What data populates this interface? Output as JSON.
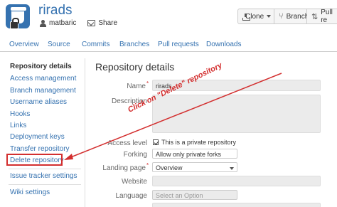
{
  "header": {
    "repo_name": "rirads",
    "owner": "matbaric",
    "share_label": "Share",
    "clone_label": "Clone",
    "branch_label": "Branch",
    "pull_label": "Pull re"
  },
  "tabs": [
    "Overview",
    "Source",
    "Commits",
    "Branches",
    "Pull requests",
    "Downloads"
  ],
  "sidebar": {
    "heading": "Repository details",
    "items": [
      "Access management",
      "Branch management",
      "Username aliases",
      "Hooks",
      "Links",
      "Deployment keys",
      "Transfer repository",
      "Delete repository",
      "Issue tracker settings",
      "Wiki settings"
    ]
  },
  "main": {
    "title": "Repository details",
    "fields": {
      "name_label": "Name",
      "name_value": "rirads",
      "description_label": "Description",
      "access_label": "Access level",
      "access_checkbox_label": "This is a private repository",
      "forking_label": "Forking",
      "forking_value": "Allow only private forks",
      "landing_label": "Landing page",
      "landing_value": "Overview",
      "website_label": "Website",
      "language_label": "Language",
      "language_placeholder": "Select an Option"
    }
  },
  "annotation": {
    "text": "Click on \"Delete\" repository",
    "color": "#d32f2f"
  },
  "colors": {
    "link": "#3572b0",
    "annotation": "#d32f2f"
  }
}
